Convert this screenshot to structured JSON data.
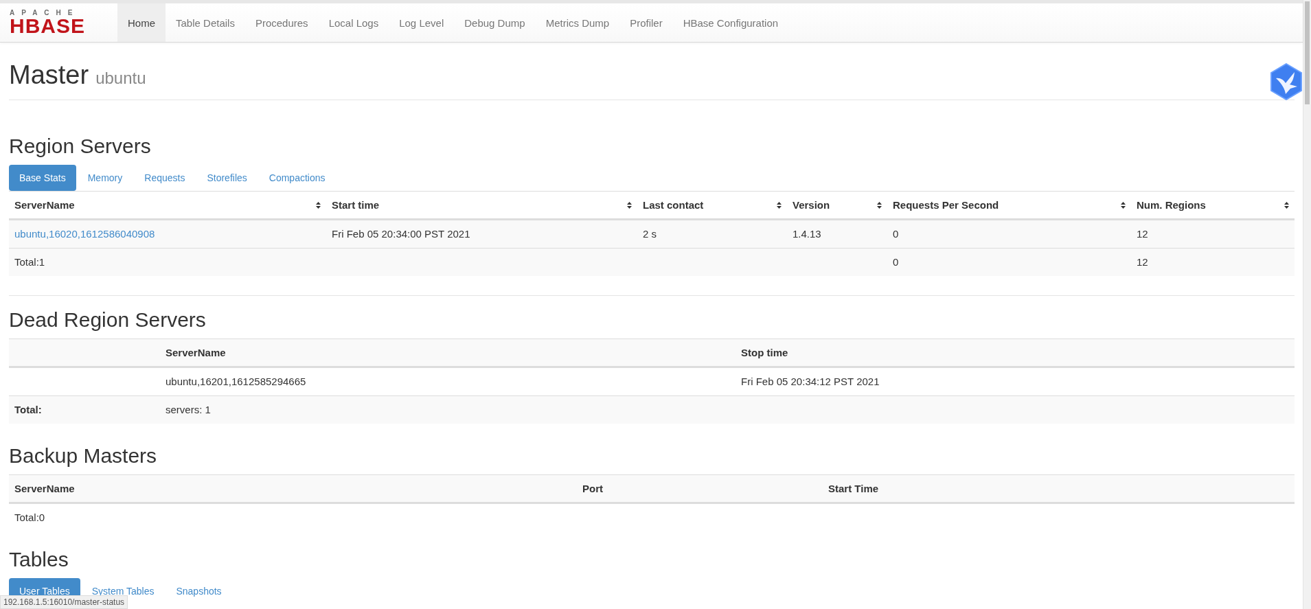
{
  "nav": {
    "logo_top": "APACHE",
    "logo_main": "HBASE",
    "items": [
      {
        "label": "Home",
        "selected": true
      },
      {
        "label": "Table Details",
        "selected": false
      },
      {
        "label": "Procedures",
        "selected": false
      },
      {
        "label": "Local Logs",
        "selected": false
      },
      {
        "label": "Log Level",
        "selected": false
      },
      {
        "label": "Debug Dump",
        "selected": false
      },
      {
        "label": "Metrics Dump",
        "selected": false
      },
      {
        "label": "Profiler",
        "selected": false
      },
      {
        "label": "HBase Configuration",
        "selected": false
      }
    ]
  },
  "header": {
    "title": "Master",
    "subtitle": "ubuntu"
  },
  "region_servers": {
    "heading": "Region Servers",
    "tabs": [
      {
        "label": "Base Stats",
        "selected": true
      },
      {
        "label": "Memory",
        "selected": false
      },
      {
        "label": "Requests",
        "selected": false
      },
      {
        "label": "Storefiles",
        "selected": false
      },
      {
        "label": "Compactions",
        "selected": false
      }
    ],
    "table": {
      "columns": [
        "ServerName",
        "Start time",
        "Last contact",
        "Version",
        "Requests Per Second",
        "Num. Regions"
      ],
      "rows": [
        {
          "kind": "server",
          "cells": [
            "ubuntu,16020,1612586040908",
            "Fri Feb 05 20:34:00 PST 2021",
            "2 s",
            "1.4.13",
            "0",
            "12"
          ]
        },
        {
          "kind": "total",
          "cells": [
            "Total:1",
            null,
            null,
            null,
            "0",
            "12"
          ]
        }
      ]
    }
  },
  "dead_region_servers": {
    "heading": "Dead Region Servers",
    "table": {
      "columns": [
        null,
        "ServerName",
        "Stop time"
      ],
      "rows": [
        {
          "kind": "server",
          "cells": [
            null,
            "ubuntu,16201,1612585294665",
            "Fri Feb 05 20:34:12 PST 2021"
          ]
        },
        {
          "kind": "total",
          "cells": [
            "Total:",
            "servers: 1",
            null
          ]
        }
      ]
    }
  },
  "backup_masters": {
    "heading": "Backup Masters",
    "table": {
      "columns": [
        "ServerName",
        "Port",
        "Start Time"
      ],
      "rows": [
        {
          "kind": "total",
          "cells": [
            "Total:0",
            null,
            null
          ]
        }
      ]
    }
  },
  "tables": {
    "heading": "Tables",
    "tabs": [
      {
        "label": "User Tables",
        "selected": true
      },
      {
        "label": "System Tables",
        "selected": false
      },
      {
        "label": "Snapshots",
        "selected": false
      }
    ]
  },
  "status_bar": {
    "url": "192.168.1.5:16010/master-status"
  }
}
